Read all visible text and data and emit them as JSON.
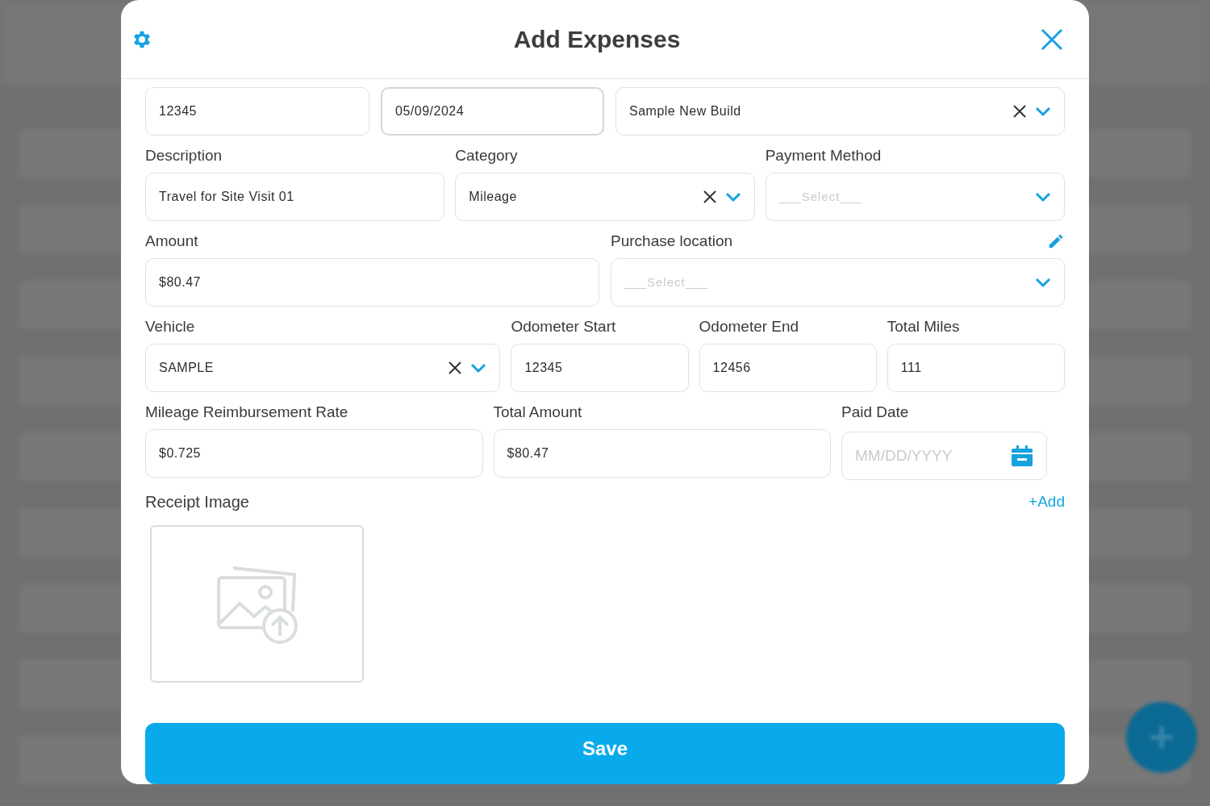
{
  "dialog": {
    "title": "Add Expenses"
  },
  "rows": [
    [
      {
        "kind": "text",
        "value": "12345"
      },
      {
        "kind": "text",
        "value": "05/09/2024",
        "selected": true
      },
      {
        "kind": "select",
        "value": "Sample New Build"
      }
    ],
    [
      {
        "kind": "text",
        "label": "Description",
        "value": "Travel for Site Visit 01"
      },
      {
        "kind": "select",
        "label": "Category",
        "value": "Mileage"
      },
      {
        "kind": "select",
        "label": "Payment Method",
        "placeholder": "___Select___"
      }
    ],
    [
      {
        "kind": "text",
        "label": "Amount",
        "value": "$80.47"
      },
      {
        "kind": "select",
        "label": "Purchase location",
        "placeholder": "___Select___",
        "editable": true
      }
    ],
    [
      {
        "kind": "select",
        "label": "Vehicle",
        "value": "SAMPLE"
      },
      {
        "kind": "text",
        "label": "Odometer Start",
        "value": "12345"
      },
      {
        "kind": "text",
        "label": "Odometer End",
        "value": "12456"
      },
      {
        "kind": "text",
        "label": "Total Miles",
        "value": "111"
      }
    ],
    [
      {
        "kind": "text",
        "label": "Mileage Reimbursement Rate",
        "value": "$0.725"
      },
      {
        "kind": "text",
        "label": "Total Amount",
        "value": "$80.47"
      },
      {
        "kind": "date",
        "label": "Paid Date",
        "placeholder": "MM/DD/YYYY"
      }
    ]
  ],
  "receipt": {
    "label": "Receipt Image",
    "add_link": "+Add"
  },
  "save_button": "Save"
}
